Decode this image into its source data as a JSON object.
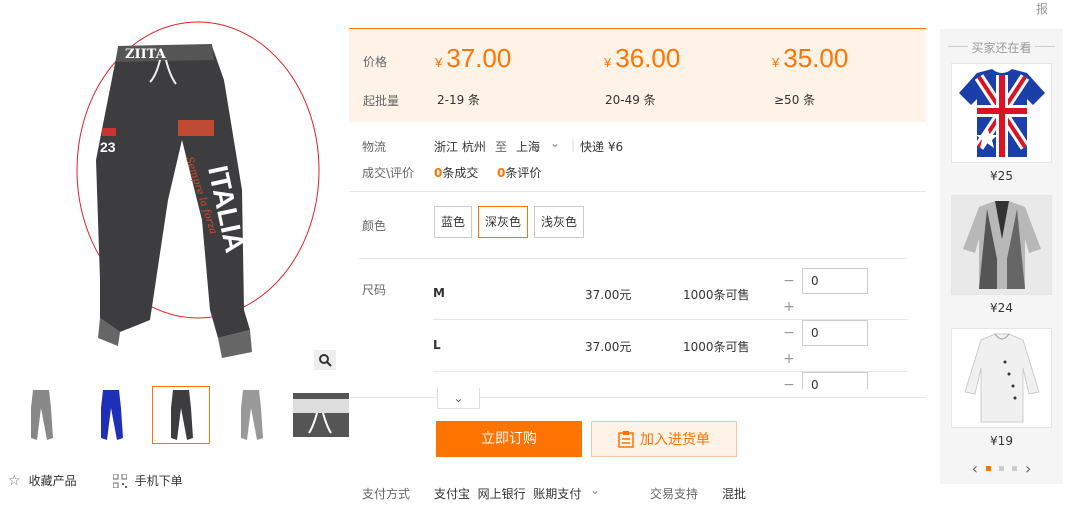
{
  "report_label": "报",
  "price_box": {
    "price_label": "价格",
    "moq_label": "起批量",
    "tiers": [
      {
        "yen": "¥",
        "price": "37.00",
        "range": "2-19 条"
      },
      {
        "yen": "¥",
        "price": "36.00",
        "range": "20-49 条"
      },
      {
        "yen": "¥",
        "price": "35.00",
        "range": "≥50 条"
      }
    ]
  },
  "logistics": {
    "label": "物流",
    "from": "浙江 杭州",
    "to_word": "至",
    "dest": "上海",
    "express": "快递 ¥6"
  },
  "deals": {
    "label": "成交\\评价",
    "deal_count": "0",
    "deal_unit": "条成交",
    "review_count": "0",
    "review_unit": "条评价"
  },
  "colors": {
    "label": "颜色",
    "options": [
      "蓝色",
      "深灰色",
      "浅灰色"
    ],
    "selected": "深灰色"
  },
  "sizes": {
    "label": "尺码",
    "rows": [
      {
        "size": "M",
        "price": "37.00元",
        "stock": "1000条可售",
        "qty": "0"
      },
      {
        "size": "L",
        "price": "37.00元",
        "stock": "1000条可售",
        "qty": "0"
      },
      {
        "size": "",
        "price": "",
        "stock": "",
        "qty": "0"
      }
    ]
  },
  "buttons": {
    "order": "立即订购",
    "cart": "加入进货单"
  },
  "payment": {
    "label": "支付方式",
    "methods": "支付宝  网上银行  账期支付",
    "support_label": "交易支持",
    "support_value": "混批"
  },
  "left_actions": {
    "favorite": "收藏产品",
    "mobile": "手机下单"
  },
  "product_image": {
    "waistband_text": "ZIITA",
    "leg_text": "ITALIA",
    "number_text": "23"
  },
  "sidebar": {
    "title": "买家还在看",
    "items": [
      {
        "price": "¥25"
      },
      {
        "price": "¥24"
      },
      {
        "price": "¥19"
      }
    ]
  },
  "colors_theme": {
    "accent": "#ff7300",
    "price_bg": "#fff3e8"
  }
}
